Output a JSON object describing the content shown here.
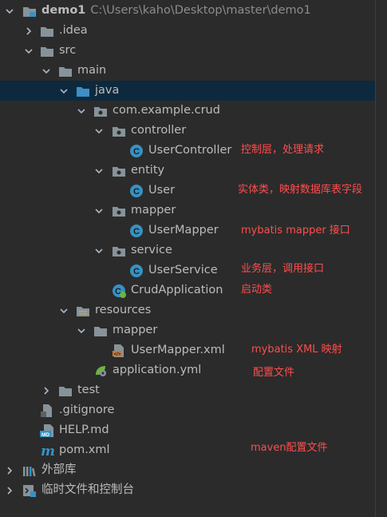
{
  "tree": {
    "root": {
      "name": "demo1",
      "path": "C:\\Users\\kaho\\Desktop\\master\\demo1"
    },
    "idea": ".idea",
    "src": "src",
    "main": "main",
    "java": "java",
    "package": "com.example.crud",
    "controller": "controller",
    "user_controller": "UserController",
    "entity": "entity",
    "user": "User",
    "mapper": "mapper",
    "user_mapper": "UserMapper",
    "service": "service",
    "user_service": "UserService",
    "crud_application": "CrudApplication",
    "resources": "resources",
    "res_mapper": "mapper",
    "user_mapper_xml": "UserMapper.xml",
    "application_yml": "application.yml",
    "test": "test",
    "gitignore": ".gitignore",
    "help_md": "HELP.md",
    "pom_xml": "pom.xml",
    "external_libs": "外部库",
    "scratches": "临时文件和控制台"
  },
  "annotations": {
    "controller": "控制层，处理请求",
    "entity": "实体类，映射数据库表字段",
    "mapper": "mybatis mapper 接口",
    "service": "业务层，调用接口",
    "app": "启动类",
    "xml": "mybatis XML 映射",
    "yml": "配置文件",
    "pom": "maven配置文件"
  },
  "icons": {
    "arrow_expanded": "chevron-down-icon",
    "arrow_collapsed": "chevron-right-icon",
    "module": "module-folder-icon",
    "folder": "folder-icon",
    "source_folder": "source-root-folder-icon",
    "package": "package-icon",
    "class": "java-class-icon",
    "spring_boot": "spring-boot-app-icon",
    "resources": "resources-folder-icon",
    "xml": "xml-file-icon",
    "yml": "spring-config-icon",
    "text": "text-file-icon",
    "markdown": "markdown-file-icon",
    "maven": "maven-icon",
    "libraries": "libraries-icon",
    "scratches": "scratches-icon"
  },
  "colors": {
    "background": "#2b2b2b",
    "selection": "#0d293e",
    "text": "#bbbbbb",
    "annotation": "#ff4d4d",
    "folder": "#87939a",
    "source_folder": "#3d8fc4",
    "class": "#3592c4"
  }
}
